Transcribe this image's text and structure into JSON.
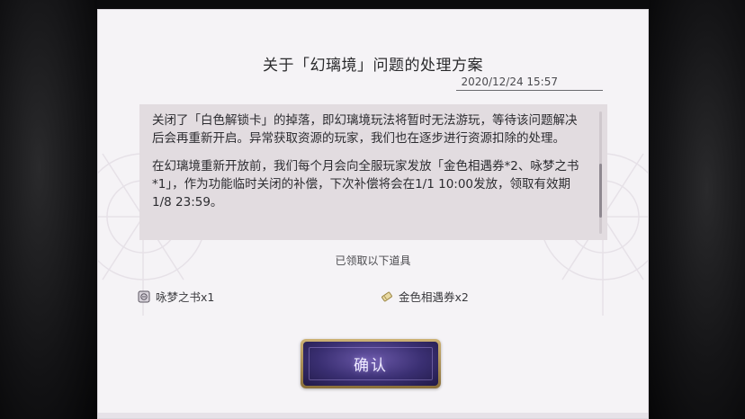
{
  "dialog": {
    "title": "关于「幻璃境」问题的处理方案",
    "date": "2020/12/24 15:57",
    "paragraphs": [
      "关闭了「白色解锁卡」的掉落，即幻璃境玩法将暂时无法游玩，等待该问题解决后会再重新开启。异常获取资源的玩家，我们也在逐步进行资源扣除的处理。",
      "在幻璃境重新开放前，我们每个月会向全服玩家发放「金色相遇券*2、咏梦之书*1」，作为功能临时关闭的补偿，下次补偿将会在1/1 10:00发放，领取有效期1/8 23:59。"
    ],
    "received_label": "已领取以下道具",
    "rewards": [
      {
        "icon": "book-icon",
        "label": "咏梦之书x1"
      },
      {
        "icon": "ticket-icon",
        "label": "金色相遇券x2"
      }
    ],
    "confirm_label": "确认"
  },
  "colors": {
    "panel": "#f5f3f6",
    "content_bg": "#e2dce0",
    "button_purple": "#3a2f72",
    "button_gold": "#cdb274"
  }
}
